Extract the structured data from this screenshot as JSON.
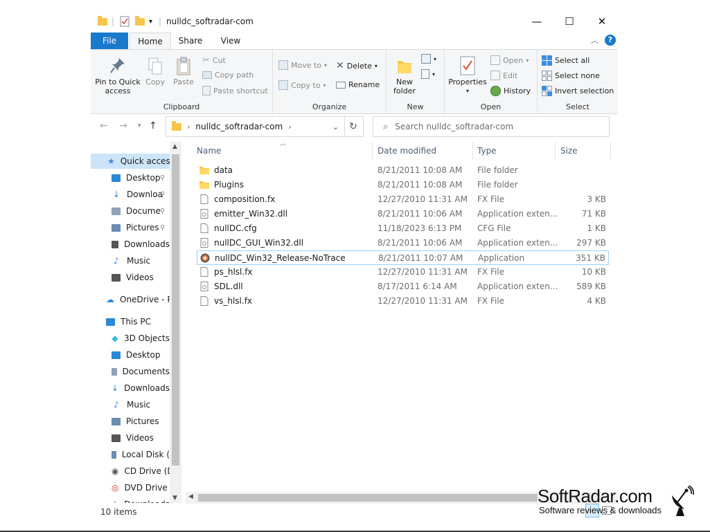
{
  "window": {
    "title": "nulldc_softradar-com",
    "minimize": "—",
    "maximize": "☐",
    "close": "✕"
  },
  "ribbon": {
    "tabs": [
      "File",
      "Home",
      "Share",
      "View"
    ],
    "clipboard": {
      "label": "Clipboard",
      "pin": "Pin to Quick access",
      "copy": "Copy",
      "paste": "Paste",
      "cut": "Cut",
      "copy_path": "Copy path",
      "paste_shortcut": "Paste shortcut"
    },
    "organize": {
      "label": "Organize",
      "move_to": "Move to",
      "copy_to": "Copy to",
      "delete": "Delete",
      "rename": "Rename"
    },
    "new": {
      "label": "New",
      "new_folder": "New folder"
    },
    "open": {
      "label": "Open",
      "properties": "Properties",
      "open": "Open",
      "edit": "Edit",
      "history": "History"
    },
    "select": {
      "label": "Select",
      "select_all": "Select all",
      "select_none": "Select none",
      "invert": "Invert selection"
    }
  },
  "address": {
    "path": "nulldc_softradar-com",
    "search_placeholder": "Search nulldc_softradar-com"
  },
  "navpane": {
    "items": [
      {
        "label": "Quick access",
        "icon": "star-icon",
        "pinned": false
      },
      {
        "label": "Desktop",
        "icon": "desktop-icon",
        "pinned": true
      },
      {
        "label": "Downloa",
        "icon": "download-icon",
        "pinned": true
      },
      {
        "label": "Docume",
        "icon": "document-icon",
        "pinned": true
      },
      {
        "label": "Pictures",
        "icon": "pictures-icon",
        "pinned": true
      },
      {
        "label": "Downloads",
        "icon": "downloads-folder-icon",
        "pinned": false
      },
      {
        "label": "Music",
        "icon": "music-icon",
        "pinned": false
      },
      {
        "label": "Videos",
        "icon": "videos-icon",
        "pinned": false
      },
      {
        "label": "OneDrive - Pe",
        "icon": "cloud-icon",
        "pinned": false
      },
      {
        "label": "This PC",
        "icon": "computer-icon",
        "pinned": false
      },
      {
        "label": "3D Objects",
        "icon": "cube-icon",
        "pinned": false
      },
      {
        "label": "Desktop",
        "icon": "desktop-icon",
        "pinned": false
      },
      {
        "label": "Documents",
        "icon": "document-icon",
        "pinned": false
      },
      {
        "label": "Downloads",
        "icon": "download-icon",
        "pinned": false
      },
      {
        "label": "Music",
        "icon": "music-icon",
        "pinned": false
      },
      {
        "label": "Pictures",
        "icon": "pictures-icon",
        "pinned": false
      },
      {
        "label": "Videos",
        "icon": "videos-icon",
        "pinned": false
      },
      {
        "label": "Local Disk (",
        "icon": "disk-icon",
        "pinned": false
      },
      {
        "label": "CD Drive (D",
        "icon": "cd-icon",
        "pinned": false
      },
      {
        "label": "DVD Drive (",
        "icon": "dvd-icon",
        "pinned": false
      },
      {
        "label": "Downloads",
        "icon": "download-icon",
        "pinned": false
      }
    ]
  },
  "columns": [
    "Name",
    "Date modified",
    "Type",
    "Size"
  ],
  "files": [
    {
      "name": "data",
      "date": "8/21/2011 10:08 AM",
      "type": "File folder",
      "size": "",
      "icon": "folder-icon"
    },
    {
      "name": "Plugins",
      "date": "8/21/2011 10:08 AM",
      "type": "File folder",
      "size": "",
      "icon": "folder-icon"
    },
    {
      "name": "composition.fx",
      "date": "12/27/2010 11:31 AM",
      "type": "FX File",
      "size": "3 KB",
      "icon": "file-icon"
    },
    {
      "name": "emitter_Win32.dll",
      "date": "8/21/2011 10:06 AM",
      "type": "Application exten...",
      "size": "71 KB",
      "icon": "dll-icon"
    },
    {
      "name": "nullDC.cfg",
      "date": "11/18/2023 6:13 PM",
      "type": "CFG File",
      "size": "1 KB",
      "icon": "file-icon"
    },
    {
      "name": "nullDC_GUI_Win32.dll",
      "date": "8/21/2011 10:06 AM",
      "type": "Application exten...",
      "size": "297 KB",
      "icon": "dll-icon"
    },
    {
      "name": "nullDC_Win32_Release-NoTrace",
      "date": "8/21/2011 10:07 AM",
      "type": "Application",
      "size": "351 KB",
      "icon": "app-icon",
      "selected": true
    },
    {
      "name": "ps_hlsl.fx",
      "date": "12/27/2010 11:31 AM",
      "type": "FX File",
      "size": "10 KB",
      "icon": "file-icon"
    },
    {
      "name": "SDL.dll",
      "date": "8/17/2011 6:14 AM",
      "type": "Application exten...",
      "size": "589 KB",
      "icon": "dll-icon"
    },
    {
      "name": "vs_hlsl.fx",
      "date": "12/27/2010 11:31 AM",
      "type": "FX File",
      "size": "4 KB",
      "icon": "file-icon"
    }
  ],
  "status": {
    "item_count": "10 items"
  },
  "watermark": {
    "title": "SoftRadar.com",
    "subtitle": "Software reviews & downloads"
  }
}
